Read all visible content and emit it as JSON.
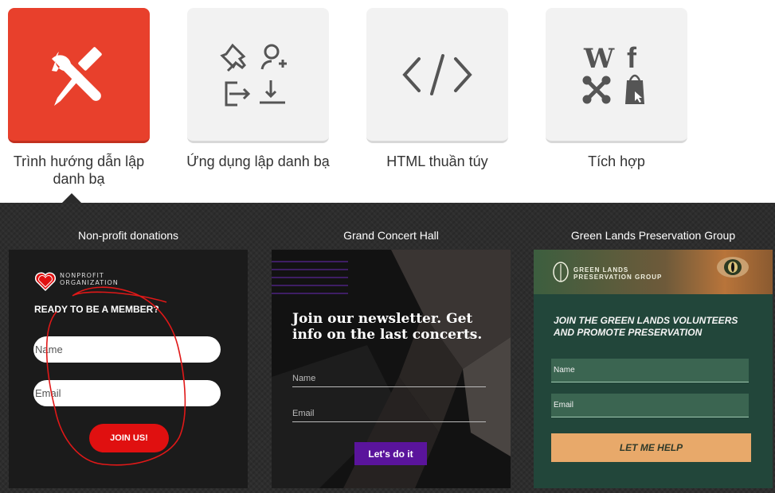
{
  "tabs": [
    {
      "label": "Trình hướng dẫn lập danh bạ",
      "icon": "tools-icon",
      "active": true
    },
    {
      "label": "Ứng dụng lập danh bạ",
      "icon": "app-icons-grid",
      "active": false
    },
    {
      "label": "HTML thuần túy",
      "icon": "code-icon",
      "active": false
    },
    {
      "label": "Tích hợp",
      "icon": "integrations-grid",
      "active": false
    }
  ],
  "colors": {
    "active_tile": "#e8402c",
    "gallery_bg": "#2d2d2d"
  },
  "templates": [
    {
      "title": "Non-profit donations",
      "logo_text": "NONPROFIT ORGANIZATION",
      "heading": "READY TO BE A MEMBER?",
      "name_placeholder": "Name",
      "email_placeholder": "Email",
      "button": "JOIN US!"
    },
    {
      "title": "Grand Concert Hall",
      "heading": "Join our newsletter. Get info on the last concerts.",
      "name_placeholder": "Name",
      "email_placeholder": "Email",
      "button": "Let's do it"
    },
    {
      "title": "Green Lands Preservation Group",
      "logo_text": "GREEN LANDS PRESERVATION GROUP",
      "heading": "JOIN THE GREEN LANDS VOLUNTEERS AND PROMOTE PRESERVATION",
      "name_placeholder": "Name",
      "email_placeholder": "Email",
      "button": "LET ME HELP"
    }
  ]
}
